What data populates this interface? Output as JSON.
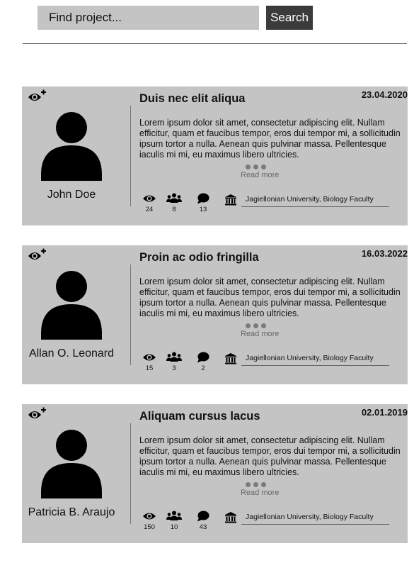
{
  "search": {
    "placeholder": "Find project...",
    "button_label": "Search"
  },
  "projects": [
    {
      "author": "John Doe",
      "title": "Duis nec elit aliqua",
      "date": "23.04.2020",
      "description": "Lorem ipsum dolor sit amet, consectetur adipiscing elit. Nullam efficitur, quam et faucibus tempor, eros dui tempor mi, a sollicitudin ipsum tortor a nulla. Aenean quis pulvinar massa. Pellentesque iaculis mi mi, eu maximus libero ultricies.",
      "read_more": "Read more",
      "views": "24",
      "members": "8",
      "comments": "13",
      "institution": "Jagiellonian University, Biology Faculty"
    },
    {
      "author": "Allan O. Leonard",
      "title": "Proin ac odio fringilla",
      "date": "16.03.2022",
      "description": "Lorem ipsum dolor sit amet, consectetur adipiscing elit. Nullam efficitur, quam et faucibus tempor, eros dui tempor mi, a sollicitudin ipsum tortor a nulla. Aenean quis pulvinar massa. Pellentesque iaculis mi mi, eu maximus libero ultricies.",
      "read_more": "Read more",
      "views": "15",
      "members": "3",
      "comments": "2",
      "institution": "Jagiellonian University, Biology Faculty"
    },
    {
      "author": "Patricia B. Araujo",
      "title": "Aliquam cursus lacus",
      "date": "02.01.2019",
      "description": "Lorem ipsum dolor sit amet, consectetur adipiscing elit. Nullam efficitur, quam et faucibus tempor, eros dui tempor mi, a sollicitudin ipsum tortor a nulla. Aenean quis pulvinar massa. Pellentesque iaculis mi mi, eu maximus libero ultricies.",
      "read_more": "Read more",
      "views": "150",
      "members": "10",
      "comments": "43",
      "institution": "Jagiellonian University, Biology Faculty"
    }
  ],
  "icons": {
    "watch": "eye-plus-icon",
    "avatar": "user-avatar-icon",
    "views": "eye-icon",
    "members": "users-icon",
    "comments": "speech-bubble-icon",
    "institution": "bank-building-icon"
  },
  "colors": {
    "card_background": "#c4c4c4",
    "search_input_background": "#c4c4c4",
    "search_button_background": "#3b3b3b",
    "read_more_text": "#666666"
  }
}
